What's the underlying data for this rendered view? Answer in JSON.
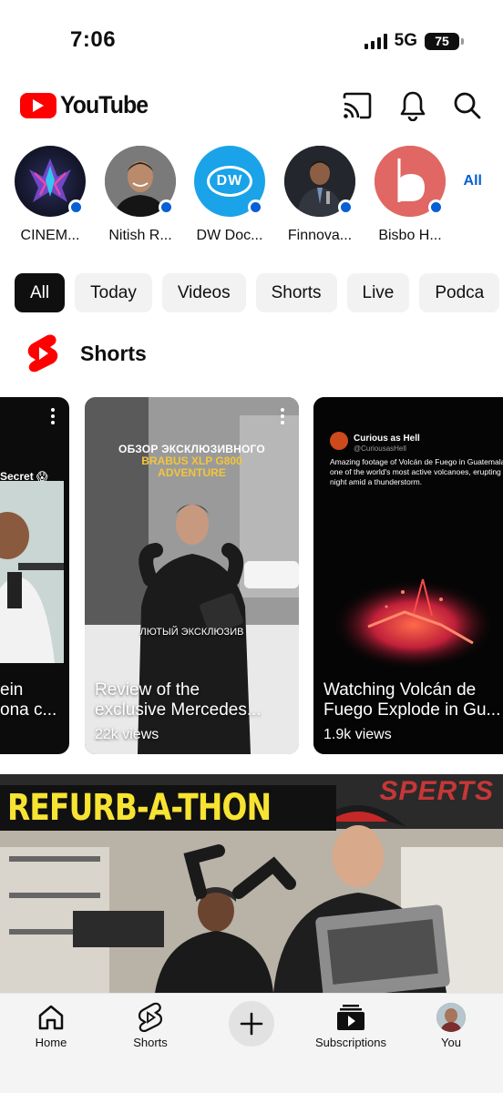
{
  "status_bar": {
    "time": "7:06",
    "network": "5G",
    "battery": "75"
  },
  "header": {
    "app_name": "YouTube"
  },
  "subscriptions": {
    "channels": [
      {
        "name": "CINEM..."
      },
      {
        "name": "Nitish R..."
      },
      {
        "name": "DW Doc...",
        "avatar_text": "DW"
      },
      {
        "name": "Finnova..."
      },
      {
        "name": "Bisbo H..."
      }
    ],
    "all_label": "All"
  },
  "chips": [
    "All",
    "Today",
    "Videos",
    "Shorts",
    "Live",
    "Podca"
  ],
  "shorts": {
    "section_title": "Shorts",
    "items": [
      {
        "title_line1": "ein",
        "title_line2": "ona c...",
        "overlay_text": "Secret 😱"
      },
      {
        "title_line1": "Review of the",
        "title_line2": "exclusive Mercedes...",
        "views": "22k views",
        "overlay_title": "ОБЗОР ЭКСКЛЮЗИВНОГО",
        "overlay_subtitle": "BRABUS XLP G800 ADVENTURE",
        "caption": "ЛЮТЫЙ ЭКСКЛЮЗИВ"
      },
      {
        "title_line1": "Watching Volcán de",
        "title_line2": "Fuego Explode in Gu...",
        "views": "1.9k views",
        "tweet_name": "Curious as Hell",
        "tweet_handle": "@CuriousasHell",
        "tweet_text": "Amazing footage of Volcán de Fuego in Guatemala, one of the world's most active volcanoes, erupting at night amid a thunderstorm."
      }
    ]
  },
  "video": {
    "thumbnail_text": "REFURB-A-THON",
    "banner_text": "SPERTS"
  },
  "bottom_nav": {
    "home": "Home",
    "shorts": "Shorts",
    "subscriptions": "Subscriptions",
    "you": "You"
  },
  "colors": {
    "brand_red": "#ff0000",
    "link_blue": "#065fd4",
    "thumb_yellow": "#f7e332"
  }
}
